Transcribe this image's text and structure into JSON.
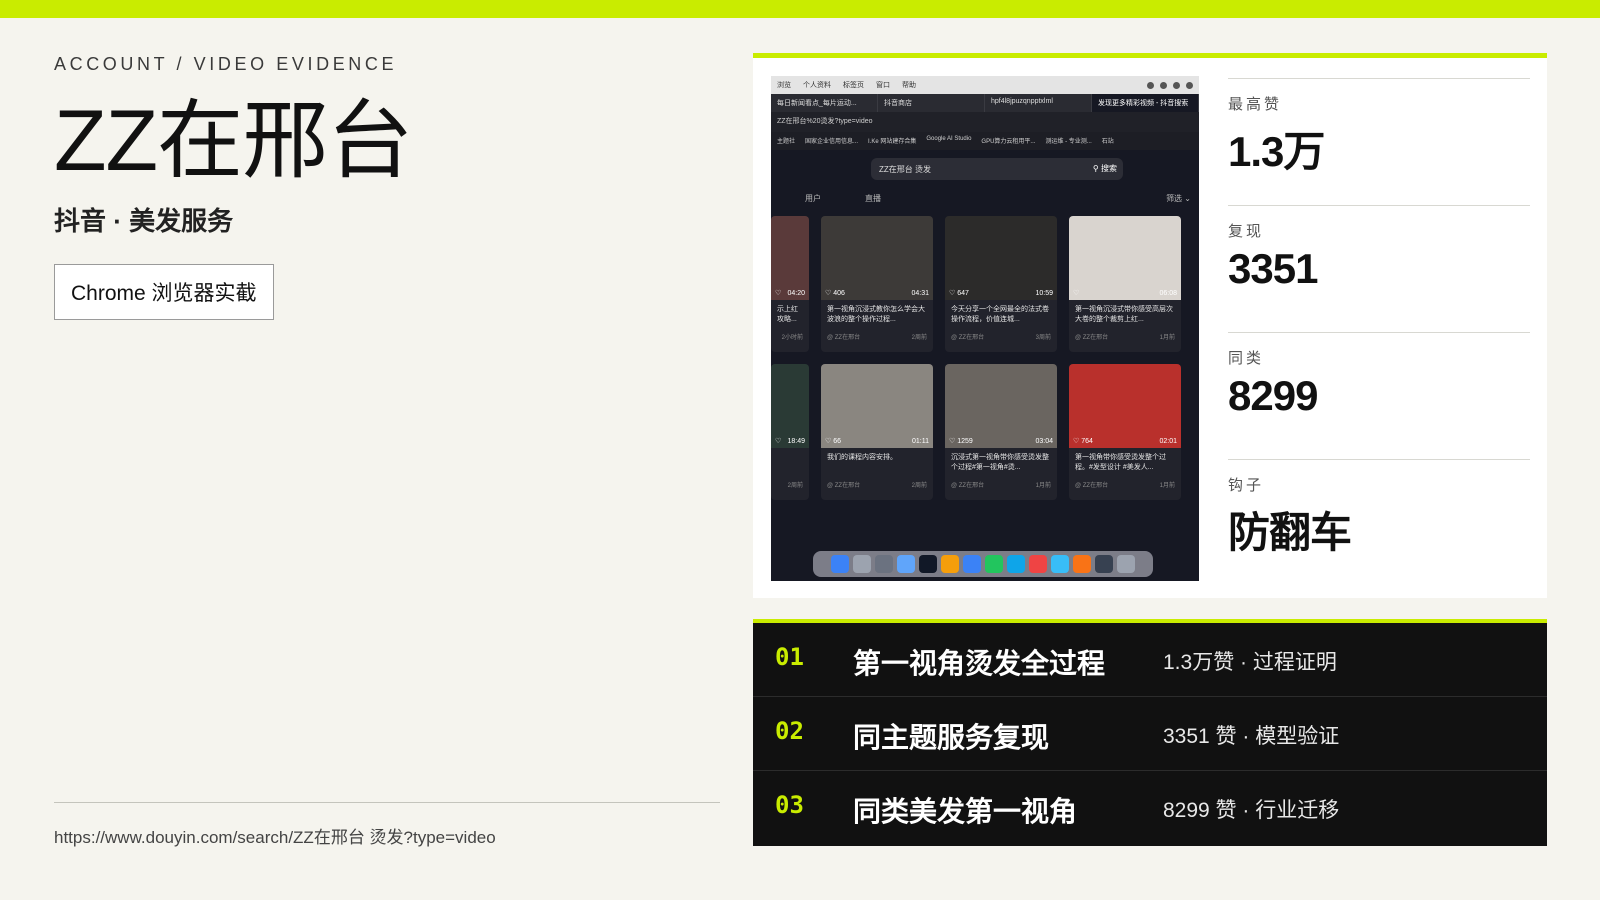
{
  "colors": {
    "accent": "#c9ec00",
    "background": "#f5f4ee",
    "dark_panel": "#111111"
  },
  "kicker": "ACCOUNT / VIDEO EVIDENCE",
  "title": "ZZ在邢台",
  "subtitle": "抖音 · 美发服务",
  "source_badge": "Chrome 浏览器实截",
  "footer_url": "https://www.douyin.com/search/ZZ在邢台 烫发?type=video",
  "screenshot": {
    "os_menu": [
      "浏览",
      "个人资料",
      "标签页",
      "窗口",
      "帮助"
    ],
    "tabs": [
      "每日新闻看点_每片运动...",
      "抖音商店",
      "hpf4l8jpuzqnpptxlml",
      "发现更多精彩视频 - 抖音搜索"
    ],
    "url": "ZZ在邢台%20烫发?type=video",
    "bookmarks": [
      "主题社",
      "国家企业信用信息...",
      "I.Ke 网站建存合集",
      "Google AI Studio",
      "GPU算力云租用平...",
      "测运维 - 专业测...",
      "石站"
    ],
    "search_text": "ZZ在邢台 烫发",
    "search_button": "搜索",
    "filters": [
      "用户",
      "直播"
    ],
    "sort_label": "筛选",
    "videos": [
      {
        "like": "",
        "duration": "04:20",
        "caption": "示上红 攻略...",
        "meta_author": "",
        "meta_time": "2小时前",
        "color": "#5a3a3a",
        "partial": true
      },
      {
        "like": "406",
        "duration": "04:31",
        "caption": "第一视角沉浸式教你怎么学会大波浪的整个操作过程...",
        "meta_author": "@ ZZ在邢台",
        "meta_time": "2周前",
        "color": "#3d3a38"
      },
      {
        "like": "647",
        "duration": "10:59",
        "caption": "今天分享一个全网最全的法式卷操作流程，价值连城...",
        "meta_author": "@ ZZ在邢台",
        "meta_time": "3周前",
        "color": "#2c2b2a"
      },
      {
        "like": "",
        "duration": "06:08",
        "caption": "第一视角沉浸式带你感受高层次大卷的整个裁剪上红...",
        "meta_author": "@ ZZ在邢台",
        "meta_time": "1月前",
        "color": "#d9d4cf"
      },
      {
        "like": "",
        "duration": "18:49",
        "caption": "",
        "meta_author": "",
        "meta_time": "2周前",
        "color": "#2a3a35",
        "partial": true
      },
      {
        "like": "66",
        "duration": "01:11",
        "caption": "我们的课程内容安排。",
        "meta_author": "@ ZZ在邢台",
        "meta_time": "2周前",
        "color": "#8a8680"
      },
      {
        "like": "1259",
        "duration": "03:04",
        "caption": "沉浸式第一视角带你感受烫发整个过程#第一视角#烫...",
        "meta_author": "@ ZZ在邢台",
        "meta_time": "1月前",
        "color": "#6a6560"
      },
      {
        "like": "764",
        "duration": "02:01",
        "caption": "第一视角带你感受烫发整个过程。#发型设计 #美发人...",
        "meta_author": "@ ZZ在邢台",
        "meta_time": "1月前",
        "color": "#b9302c"
      }
    ],
    "dock_colors": [
      "#3b82f6",
      "#9ca3af",
      "#6b7280",
      "#60a5fa",
      "#111827",
      "#f59e0b",
      "#3b82f6",
      "#22c55e",
      "#0ea5e9",
      "#ef4444",
      "#38bdf8",
      "#f97316",
      "#374151",
      "#9ca3af"
    ]
  },
  "metrics": [
    {
      "label": "最高赞",
      "value": "1.3万"
    },
    {
      "label": "复现",
      "value": "3351"
    },
    {
      "label": "同类",
      "value": "8299"
    },
    {
      "label": "钩子",
      "value": "防翻车"
    }
  ],
  "evidence_rows": [
    {
      "num": "01",
      "title": "第一视角烫发全过程",
      "note": "1.3万赞 · 过程证明"
    },
    {
      "num": "02",
      "title": "同主题服务复现",
      "note": "3351 赞 · 模型验证"
    },
    {
      "num": "03",
      "title": "同类美发第一视角",
      "note": "8299 赞 · 行业迁移"
    }
  ]
}
